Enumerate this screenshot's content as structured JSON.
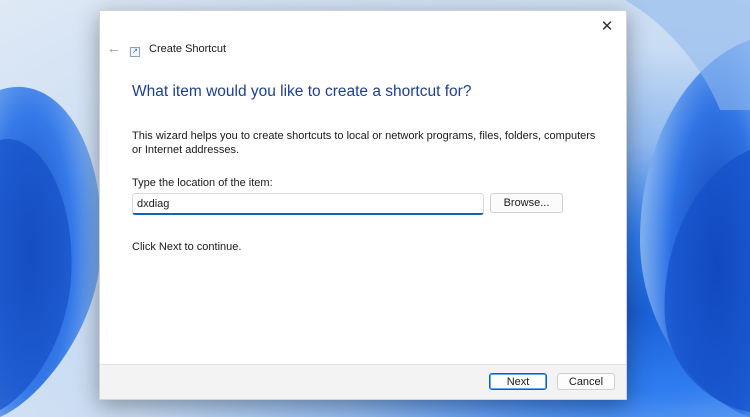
{
  "dialog": {
    "title": "Create Shortcut",
    "back_icon": "arrow-left-icon",
    "close_icon": "close-icon",
    "heading": "What item would you like to create a shortcut for?",
    "description": "This wizard helps you to create shortcuts to local or network programs, files, folders, computers or Internet addresses.",
    "location_label": "Type the location of the item:",
    "location_value": "dxdiag",
    "browse_label": "Browse...",
    "hint": "Click Next to continue.",
    "next_label": "Next",
    "cancel_label": "Cancel"
  },
  "colors": {
    "heading": "#1c3f94",
    "accent": "#1a5fb4"
  }
}
